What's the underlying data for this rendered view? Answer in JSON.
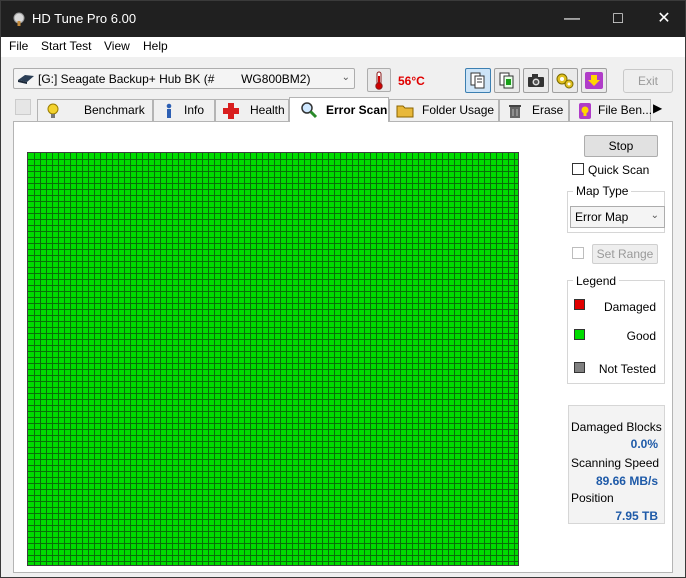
{
  "window": {
    "title": "HD Tune Pro 6.00"
  },
  "menu": [
    "File",
    "Start Test",
    "View",
    "Help"
  ],
  "toolbar": {
    "drive": "[G:] Seagate Backup+ Hub BK (#        WG800BM2)",
    "temperature": "56°C",
    "exit_label": "Exit"
  },
  "tabs": [
    {
      "label": "Benchmark",
      "icon": "lightbulb-icon"
    },
    {
      "label": "Info",
      "icon": "info-icon"
    },
    {
      "label": "Health",
      "icon": "cross-icon"
    },
    {
      "label": "Error Scan",
      "icon": "magnifier-icon",
      "active": true
    },
    {
      "label": "Folder Usage",
      "icon": "folder-icon"
    },
    {
      "label": "Erase",
      "icon": "trash-icon"
    },
    {
      "label": "File Ben...",
      "icon": "file-icon"
    }
  ],
  "scan": {
    "stop_label": "Stop",
    "quick_scan_label": "Quick Scan",
    "map_type_title": "Map Type",
    "map_type_value": "Error Map",
    "set_range_label": "Set Range",
    "legend_title": "Legend",
    "legend": [
      {
        "label": "Damaged",
        "color": "#e00000"
      },
      {
        "label": "Good",
        "color": "#00dc00"
      },
      {
        "label": "Not Tested",
        "color": "#808080"
      }
    ],
    "grid_color": "#00dc00",
    "damaged_blocks_label": "Damaged Blocks",
    "damaged_blocks_value": "0.0%",
    "scanning_speed_label": "Scanning Speed",
    "scanning_speed_value": "89.66 MB/s",
    "position_label": "Position",
    "position_value": "7.95 TB"
  }
}
